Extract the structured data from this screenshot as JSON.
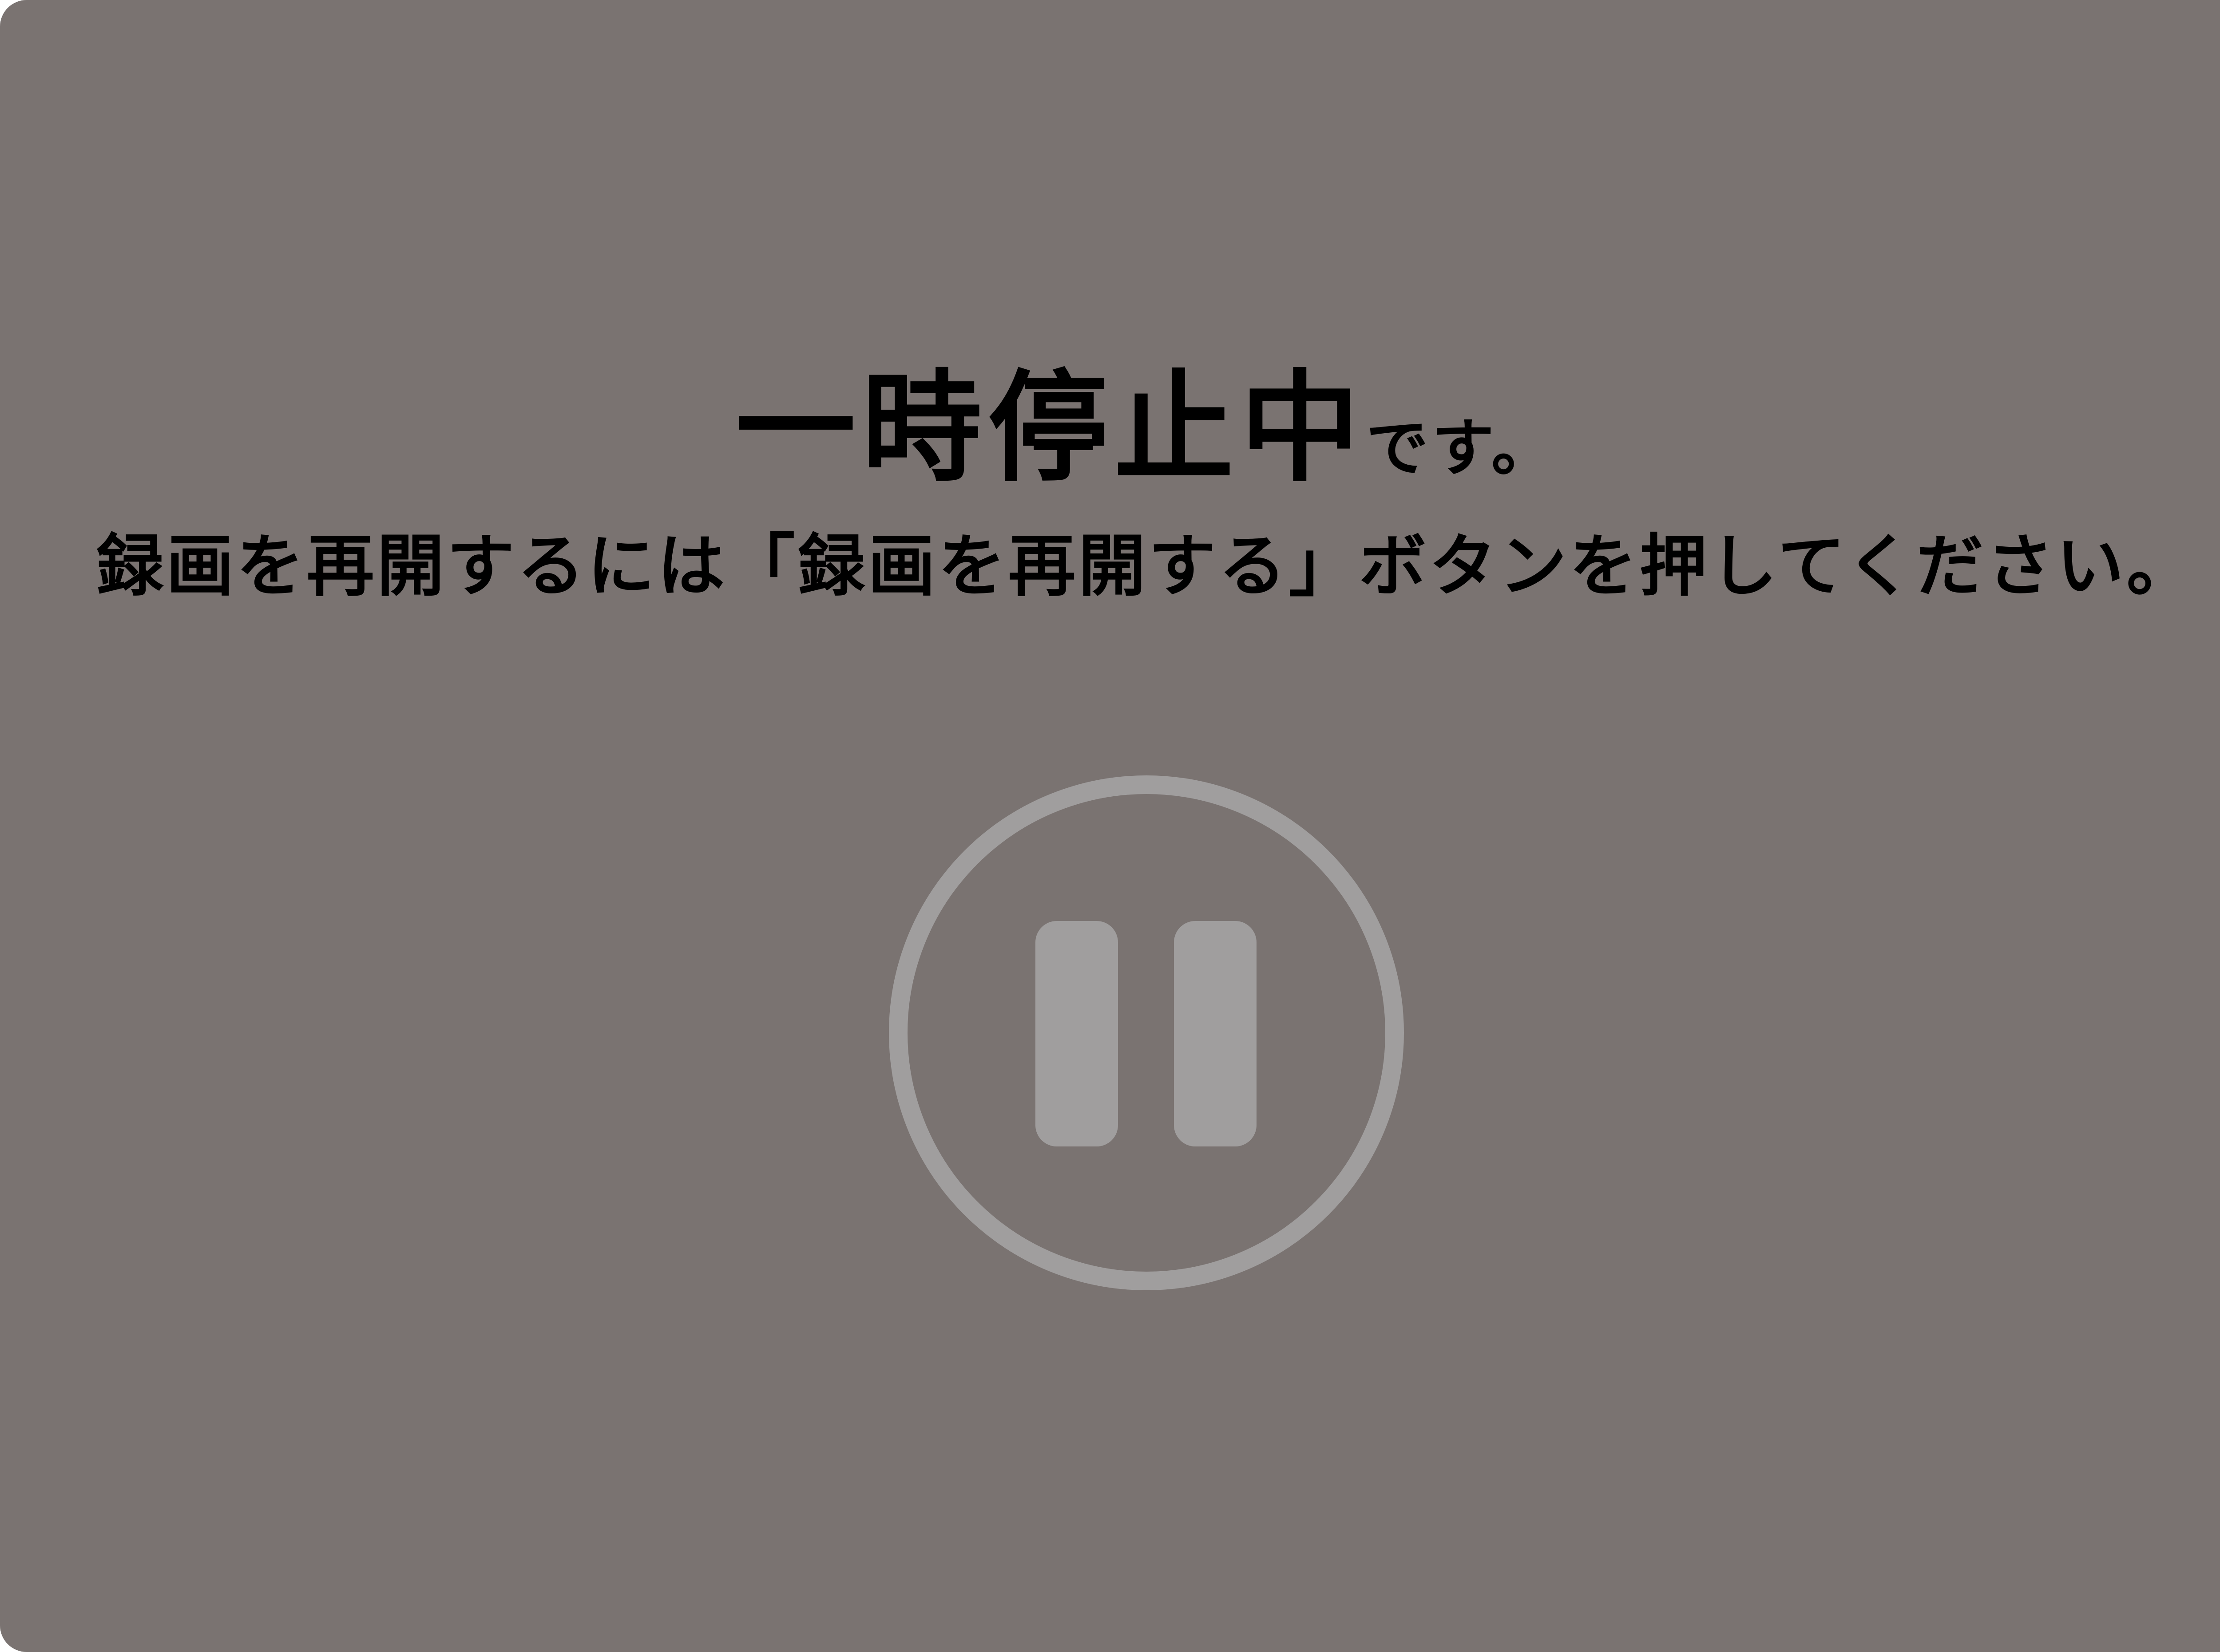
{
  "status": {
    "title_main": "一時停止中",
    "title_suffix": "です。",
    "instruction": "録画を再開するには「録画を再開する」ボタンを押してください。"
  },
  "icon": {
    "name": "pause-icon",
    "color": "#a09e9e"
  },
  "colors": {
    "background": "#7a7371",
    "text": "#000000"
  }
}
